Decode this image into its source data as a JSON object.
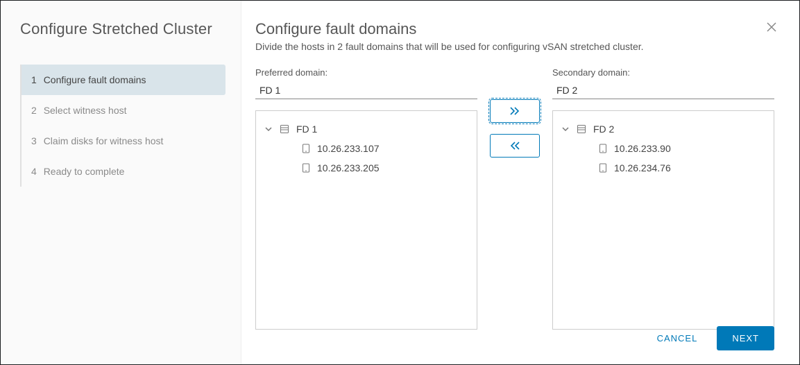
{
  "wizard": {
    "title": "Configure Stretched Cluster",
    "steps": [
      {
        "num": "1",
        "label": "Configure fault domains"
      },
      {
        "num": "2",
        "label": "Select witness host"
      },
      {
        "num": "3",
        "label": "Claim disks for witness host"
      },
      {
        "num": "4",
        "label": "Ready to complete"
      }
    ],
    "activeStep": 0
  },
  "page": {
    "title": "Configure fault domains",
    "subtitle": "Divide the hosts in 2 fault domains that will be used for configuring vSAN stretched cluster."
  },
  "preferred": {
    "label": "Preferred domain:",
    "value": "FD 1",
    "treeRoot": "FD 1",
    "hosts": [
      "10.26.233.107",
      "10.26.233.205"
    ]
  },
  "secondary": {
    "label": "Secondary domain:",
    "value": "FD 2",
    "treeRoot": "FD 2",
    "hosts": [
      "10.26.233.90",
      "10.26.234.76"
    ]
  },
  "footer": {
    "cancel": "CANCEL",
    "next": "NEXT"
  },
  "icons": {
    "close": "close-icon",
    "chevron": "chevron-down-icon",
    "domain": "fault-domain-icon",
    "host": "host-icon",
    "moveRight": "double-chevron-right-icon",
    "moveLeft": "double-chevron-left-icon"
  }
}
